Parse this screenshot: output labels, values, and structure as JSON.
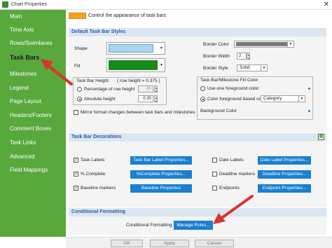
{
  "window": {
    "title": "Chart Properties",
    "close_glyph": "✕"
  },
  "sidebar": {
    "items": [
      {
        "label": "Main"
      },
      {
        "label": "Time Axis"
      },
      {
        "label": "Rows/Swimlanes"
      },
      {
        "label": "Task Bars",
        "active": true
      },
      {
        "label": "Milestones"
      },
      {
        "label": "Legend"
      },
      {
        "label": "Page Layout"
      },
      {
        "label": "Headers/Footers"
      },
      {
        "label": "Comment Boxes"
      },
      {
        "label": "Task Links"
      },
      {
        "label": "Advanced"
      },
      {
        "label": "Field Mappings"
      }
    ]
  },
  "top": {
    "description": "Control the appearance of task bars",
    "swatch_color": "#f4a21c"
  },
  "default_styles": {
    "heading": "Default Task Bar Styles",
    "shape_label": "Shape",
    "shape_color": "#a8d4ee",
    "fill_label": "Fill",
    "fill_color": "#1a8a1a",
    "border_color_label": "Border Color",
    "border_color_value": "#7a7a7a",
    "border_width_label": "Border Width",
    "border_width_value": "2",
    "border_style_label": "Border Style",
    "border_style_value": "Solid",
    "height_group_title": "Task Bar Height",
    "row_height_note": "( row height =  0.375 )",
    "percentage_label": "Percentage of row height",
    "percentage_value": "80",
    "absolute_label": "Absolute height",
    "absolute_value": "0.30",
    "mirror_label": "Mirror format changes between task bars and milestones",
    "fill_group_title": "Task Bar/Milestone Fill Color",
    "one_fg_label": "Use one foreground color:",
    "fg_based_label": "Color foreground based on",
    "fg_based_value": "Category",
    "background_label": "Background Color"
  },
  "decorations": {
    "heading": "Task Bar Decorations",
    "task_labels": "Task Labels",
    "task_labels_btn": "Task Bar Label Properties...",
    "complete": "% Complete",
    "complete_btn": "%Complete Properties...",
    "baseline": "Baseline markers",
    "baseline_btn": "Baseline Properties",
    "date_labels": "Date Labels",
    "date_labels_btn": "Date Label Properties...",
    "deadline": "Deadline markers",
    "deadline_btn": "Deadline Properties...",
    "endpoints": "Endpoints",
    "endpoints_btn": "Endpoint Properties...",
    "check_glyph": "✓"
  },
  "conditional": {
    "heading": "Conditional Formatting",
    "label": "Conditional Formatting",
    "button": "Manage Rules..."
  },
  "footer": {
    "ok": "OK",
    "apply": "Apply",
    "cancel": "Cancel"
  },
  "colors": {
    "sidebar": "#58a83c",
    "accent_blue": "#1a7fd0",
    "annotation_arrow": "#d9342b"
  }
}
